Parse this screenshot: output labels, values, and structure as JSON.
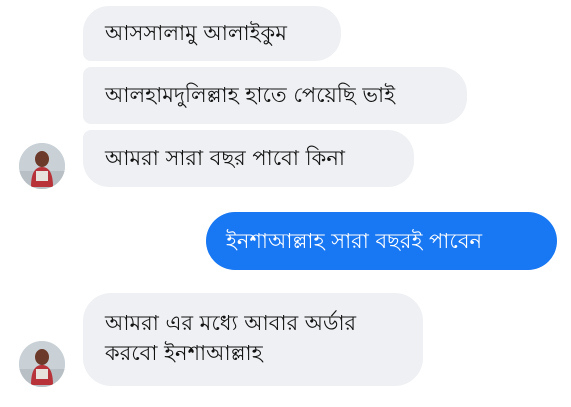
{
  "conversation": {
    "messages": [
      {
        "direction": "incoming",
        "text": "আসসালামু আলাইকুম"
      },
      {
        "direction": "incoming",
        "text": "আলহামদুলিল্লাহ হাতে পেয়েছি ভাই"
      },
      {
        "direction": "incoming",
        "text": "আমরা সারা বছর পাবো কিনা"
      },
      {
        "direction": "outgoing",
        "text": "ইনশাআল্লাহ সারা বছরই পাবেন"
      },
      {
        "direction": "incoming",
        "lines": [
          "আমরা এর মধ্যে আবার অর্ডার",
          "করবো ইনশাআল্লাহ"
        ]
      }
    ]
  },
  "colors": {
    "incoming_bubble": "#eef0f3",
    "outgoing_bubble": "#1877f2",
    "outgoing_text": "#ffffff",
    "incoming_text": "#121212"
  },
  "icons": {
    "avatar": "contact-avatar-photo"
  }
}
